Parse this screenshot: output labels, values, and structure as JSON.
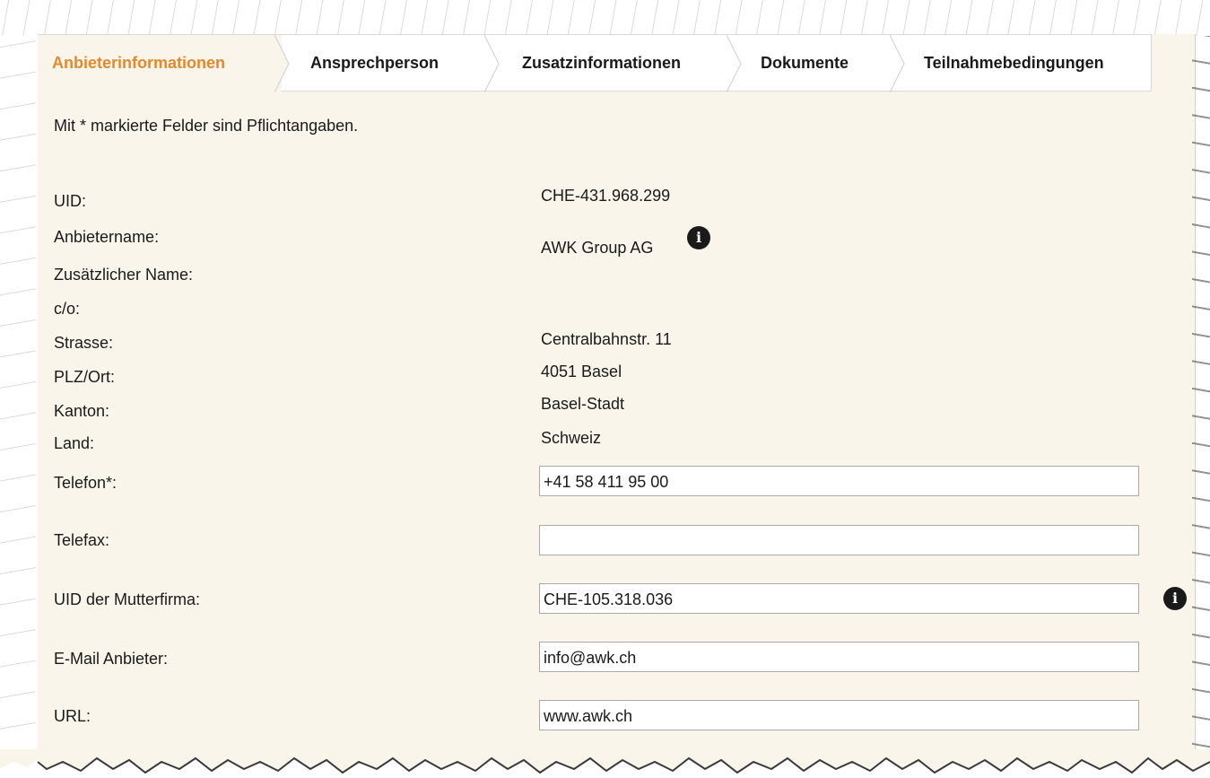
{
  "tabs": [
    {
      "label": "Anbieterinformationen",
      "active": true
    },
    {
      "label": "Ansprechperson",
      "active": false
    },
    {
      "label": "Zusatzinformationen",
      "active": false
    },
    {
      "label": "Dokumente",
      "active": false
    },
    {
      "label": "Teilnahmebedingungen",
      "active": false
    }
  ],
  "note": "Mit * markierte Felder sind Pflichtangaben.",
  "static_rows": [
    {
      "label": "UID:",
      "value": "CHE-431.968.299"
    },
    {
      "label": "Anbietername:",
      "value": "AWK Group AG"
    },
    {
      "label": "Zusätzlicher Name:",
      "value": ""
    },
    {
      "label": "c/o:",
      "value": ""
    },
    {
      "label": "Strasse:",
      "value": "Centralbahnstr. 11"
    },
    {
      "label": "PLZ/Ort:",
      "value": "4051 Basel"
    },
    {
      "label": "Kanton:",
      "value": "Basel-Stadt"
    },
    {
      "label": "Land:",
      "value": "Schweiz"
    }
  ],
  "input_rows": [
    {
      "label": "Telefon*:",
      "value": "+41 58 411 95 00"
    },
    {
      "label": "Telefax:",
      "value": ""
    },
    {
      "label": "UID der Mutterfirma:",
      "value": "CHE-105.318.036"
    },
    {
      "label": "E-Mail Anbieter:",
      "value": "info@awk.ch"
    },
    {
      "label": "URL:",
      "value": "www.awk.ch"
    }
  ],
  "icons": {
    "info": "info-icon",
    "info_glyph": "i"
  },
  "colors": {
    "active_tab": "#e4882a",
    "panel_bg": "#f9f5ea"
  }
}
